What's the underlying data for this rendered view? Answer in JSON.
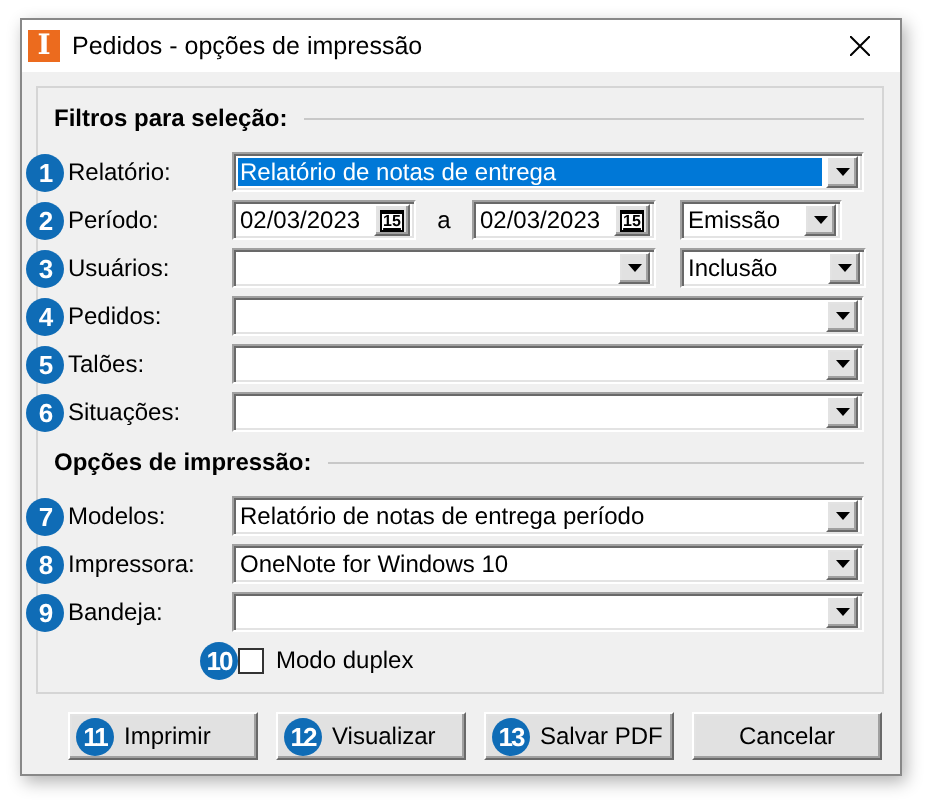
{
  "window": {
    "app_icon": "I",
    "title": "Pedidos - opções de impressão"
  },
  "filters": {
    "heading": "Filtros para seleção:",
    "rows": [
      {
        "kind": "combo",
        "badge": "1",
        "label": "Relatório:",
        "value": "Relatório de notas de entrega",
        "focused": true
      },
      {
        "kind": "period",
        "badge": "2",
        "label": "Período:",
        "from": "02/03/2023",
        "from_picker": "15",
        "separator": "a",
        "to": "02/03/2023",
        "to_picker": "15",
        "option": "Emissão"
      },
      {
        "kind": "split",
        "badge": "3",
        "label": "Usuários:",
        "option": "Inclusão"
      },
      {
        "kind": "combo",
        "badge": "4",
        "label": "Pedidos:",
        "focused": false
      },
      {
        "kind": "combo",
        "badge": "5",
        "label": "Talões:",
        "focused": false
      },
      {
        "kind": "combo",
        "badge": "6",
        "label": "Situações:",
        "focused": false
      }
    ]
  },
  "print_options": {
    "heading": "Opções de impressão:",
    "rows": [
      {
        "kind": "combo",
        "badge": "7",
        "label": "Modelos:",
        "value": "Relatório de notas de entrega período",
        "focused": false
      },
      {
        "kind": "combo",
        "badge": "8",
        "label": "Impressora:",
        "value": "OneNote for Windows 10",
        "focused": false
      },
      {
        "kind": "combo",
        "badge": "9",
        "label": "Bandeja:",
        "focused": false
      },
      {
        "kind": "check",
        "badge": "10",
        "label": "Modo duplex",
        "checked": false
      }
    ]
  },
  "buttons": [
    {
      "badge": "11",
      "label": "Imprimir"
    },
    {
      "badge": "12",
      "label": "Visualizar"
    },
    {
      "badge": "13",
      "label": "Salvar PDF"
    },
    {
      "label": "Cancelar"
    }
  ]
}
